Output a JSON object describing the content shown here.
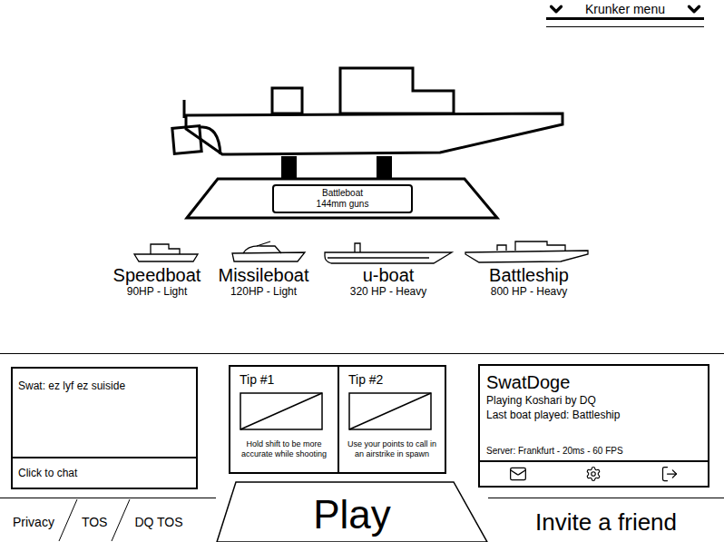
{
  "menu": {
    "label": "Krunker menu"
  },
  "showcase": {
    "name": "Battleboat",
    "weapon": "144mm guns"
  },
  "boats": [
    {
      "name": "Speedboat",
      "stats": "90HP - Light",
      "kind": "speedboat"
    },
    {
      "name": "Missileboat",
      "stats": "120HP - Light",
      "kind": "missileboat"
    },
    {
      "name": "u-boat",
      "stats": "320 HP - Heavy",
      "kind": "uboat"
    },
    {
      "name": "Battleship",
      "stats": "800 HP - Heavy",
      "kind": "battleship"
    }
  ],
  "chat": {
    "messages": [
      "Swat: ez lyf ez suiside"
    ],
    "input_placeholder": "Click to chat"
  },
  "tips": [
    {
      "title": "Tip #1",
      "text": "Hold shift to be more accurate while shooting"
    },
    {
      "title": "Tip #2",
      "text": "Use your points to call in an airstrike in spawn"
    }
  ],
  "profile": {
    "name": "SwatDoge",
    "playing": "Playing Koshari by DQ",
    "last_boat": "Last boat played: Battleship",
    "server": "Server: Frankfurt - 20ms - 60 FPS"
  },
  "footer_links": [
    "Privacy",
    "TOS",
    "DQ TOS"
  ],
  "play_button": "Play",
  "invite_button": "Invite a friend"
}
